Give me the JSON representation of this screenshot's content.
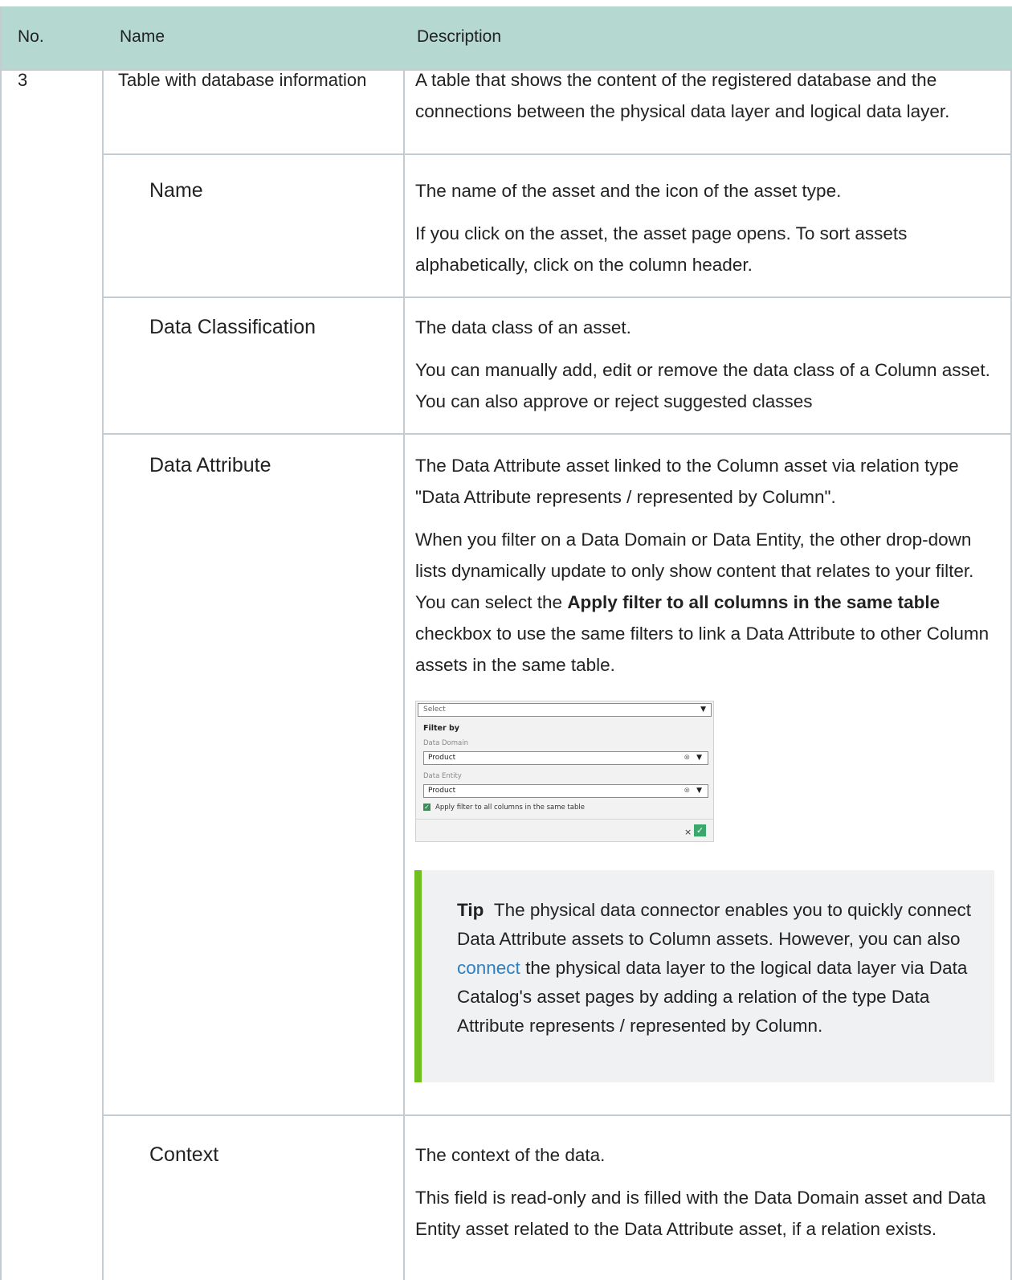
{
  "header": {
    "col_no": "No.",
    "col_name": "Name",
    "col_description": "Description"
  },
  "row": {
    "number": "3",
    "name": "Table with database information",
    "description": "A table that shows the content of the registered database and the connections between the physical data layer and logical data layer."
  },
  "subrows": [
    {
      "name": "Name",
      "p1": "The name of the asset and the icon of the asset type.",
      "p2": "If you click on the asset, the asset page opens. To sort assets alphabetically, click on the column header."
    },
    {
      "name": "Data Classification",
      "p1": "The data class of an asset.",
      "p2": "You can manually add, edit or remove the data class of a Column asset. You can also approve or reject suggested classes"
    },
    {
      "name": "Data Attribute",
      "p1": "The Data Attribute asset linked to the Column asset via relation type \"Data Attribute represents / represented by Column\".",
      "p2_before": "When you filter on a Data Domain or Data Entity, the other drop-down lists dynamically update to only show content that relates to your filter. You can select the ",
      "p2_bold": "Apply filter to all columns in the same table",
      "p2_after": " checkbox to use the same filters to link a Data Attribute to other Column assets in the same table."
    },
    {
      "name": "Context",
      "p1": "The context of the data.",
      "p2": "This field is read-only and is filled with the Data Domain asset and Data Entity asset related to the Data Attribute asset, if a relation exists."
    }
  ],
  "widget": {
    "select_placeholder": "Select",
    "filter_by": "Filter by",
    "domain_label": "Data Domain",
    "domain_value": "Product",
    "entity_label": "Data Entity",
    "entity_value": "Product",
    "checkbox_label": "Apply filter to all columns in the same table",
    "checkbox_checked": true,
    "check_color": "#3aa76d"
  },
  "tip": {
    "label": "Tip",
    "text_before": "The physical data connector enables you to quickly connect Data Attribute assets to Column assets. However, you can also ",
    "link": "connect",
    "text_after": " the physical data layer to the logical data layer via Data Catalog's asset pages by adding a relation of the type Data Attribute represents / represented by Column.",
    "accent_color": "#6fbf1f"
  },
  "colors": {
    "header_bg": "#b5d8d1",
    "link": "#2d7fc0",
    "border": "#c5ccd1"
  }
}
